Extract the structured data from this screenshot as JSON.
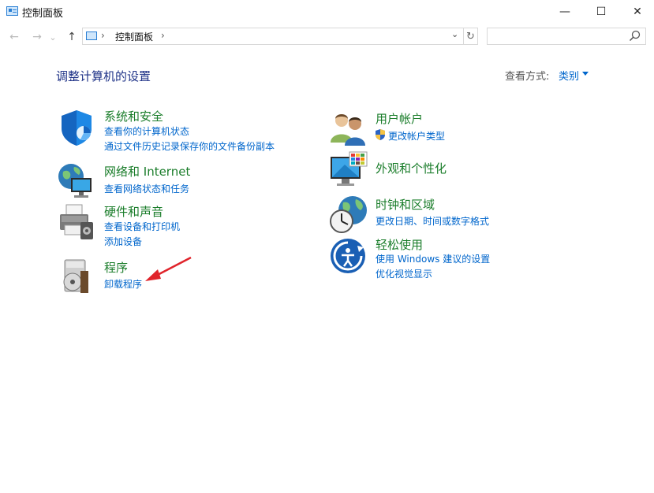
{
  "window": {
    "title": "控制面板",
    "controls": {
      "minimize": "—",
      "maximize": "☐",
      "close": "✕"
    }
  },
  "nav": {
    "back": "←",
    "forward": "→",
    "recent": "⌄",
    "up": "↑"
  },
  "address": {
    "separator": "›",
    "path": "控制面板",
    "dropdown": "⌄",
    "refresh": "↻"
  },
  "search": {
    "placeholder": "",
    "value": ""
  },
  "header": {
    "title": "调整计算机的设置",
    "view_label": "查看方式:",
    "view_value": "类别"
  },
  "categories": [
    {
      "title": "系统和安全",
      "links": [
        "查看你的计算机状态",
        "通过文件历史记录保存你的文件备份副本"
      ],
      "icon": "shield-icon"
    },
    {
      "title": "网络和 Internet",
      "links": [
        "查看网络状态和任务"
      ],
      "icon": "network-globe-icon"
    },
    {
      "title": "硬件和声音",
      "links": [
        "查看设备和打印机",
        "添加设备"
      ],
      "icon": "printer-icon"
    },
    {
      "title": "程序",
      "links": [
        "卸载程序"
      ],
      "icon": "programs-disc-icon"
    },
    {
      "title": "用户帐户",
      "links": [
        "更改帐户类型"
      ],
      "icon": "users-icon"
    },
    {
      "title": "外观和个性化",
      "links": [],
      "icon": "monitor-palette-icon"
    },
    {
      "title": "时钟和区域",
      "links": [
        "更改日期、时间或数字格式"
      ],
      "icon": "clock-globe-icon"
    },
    {
      "title": "轻松使用",
      "links": [
        "使用 Windows 建议的设置",
        "优化视觉显示"
      ],
      "icon": "accessibility-icon"
    }
  ],
  "annotation": {
    "arrow_color": "#e0242b"
  }
}
